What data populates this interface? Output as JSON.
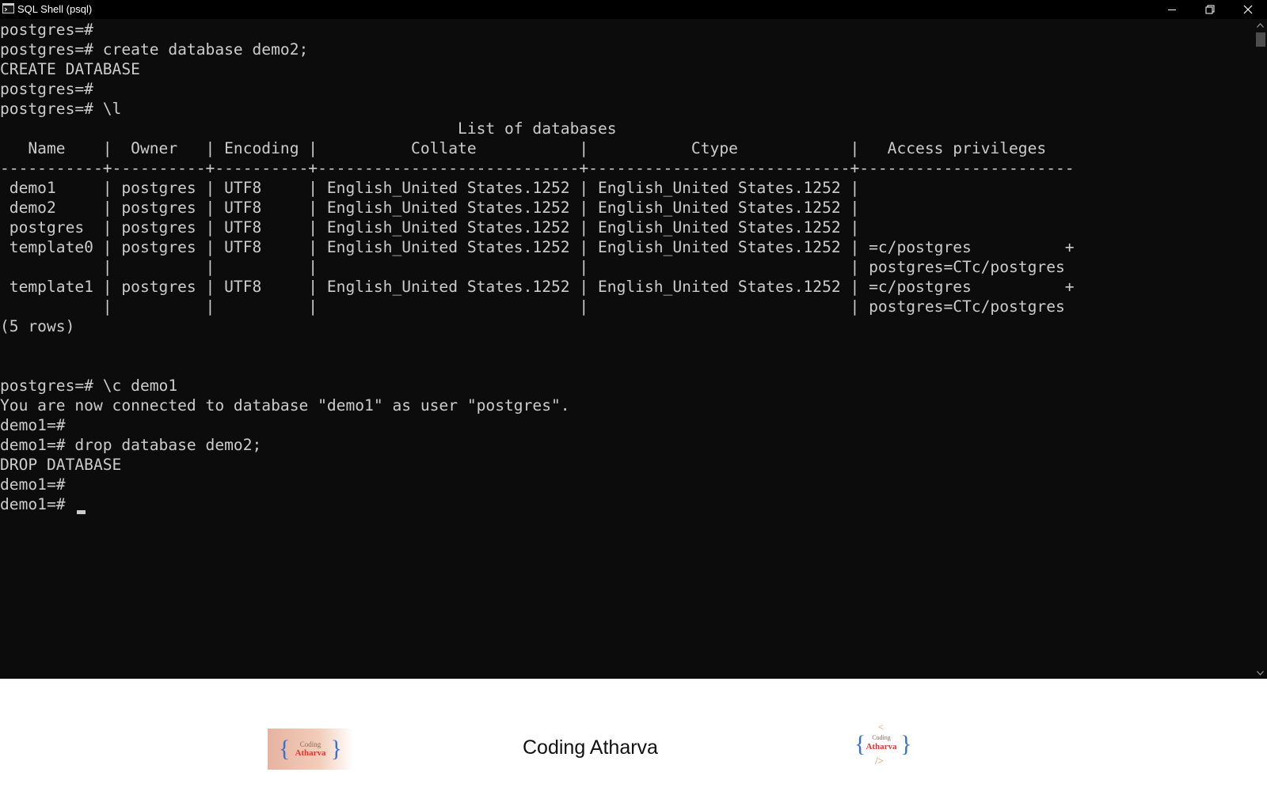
{
  "window": {
    "title": "SQL Shell (psql)",
    "controls": [
      "minimize",
      "restore",
      "close"
    ]
  },
  "terminal": {
    "lines": [
      "postgres=#",
      "postgres=# create database demo2;",
      "CREATE DATABASE",
      "postgres=#",
      "postgres=# \\l",
      "                                                 List of databases",
      "   Name    |  Owner   | Encoding |          Collate           |           Ctype            |   Access privileges",
      "-----------+----------+----------+----------------------------+----------------------------+-----------------------",
      " demo1     | postgres | UTF8     | English_United States.1252 | English_United States.1252 |",
      " demo2     | postgres | UTF8     | English_United States.1252 | English_United States.1252 |",
      " postgres  | postgres | UTF8     | English_United States.1252 | English_United States.1252 |",
      " template0 | postgres | UTF8     | English_United States.1252 | English_United States.1252 | =c/postgres          +",
      "           |          |          |                            |                            | postgres=CTc/postgres",
      " template1 | postgres | UTF8     | English_United States.1252 | English_United States.1252 | =c/postgres          +",
      "           |          |          |                            |                            | postgres=CTc/postgres",
      "(5 rows)",
      "",
      "",
      "postgres=# \\c demo1",
      "You are now connected to database \"demo1\" as user \"postgres\".",
      "demo1=#",
      "demo1=# drop database demo2;",
      "DROP DATABASE",
      "demo1=#",
      "demo1=# "
    ]
  },
  "footer": {
    "brand": "Coding Atharva",
    "logo_left": {
      "line1": "Coding",
      "line2": "Atharva"
    },
    "logo_right": {
      "top": "<",
      "line1": "Coding",
      "line2": "Atharva",
      "bottom": "/>"
    }
  },
  "colors": {
    "terminal_bg": "#0c0c0c",
    "terminal_fg": "#cccccc",
    "titlebar_bg": "#000000",
    "logo_accent": "#e03a2f",
    "logo_brace": "#3a6fd8"
  }
}
